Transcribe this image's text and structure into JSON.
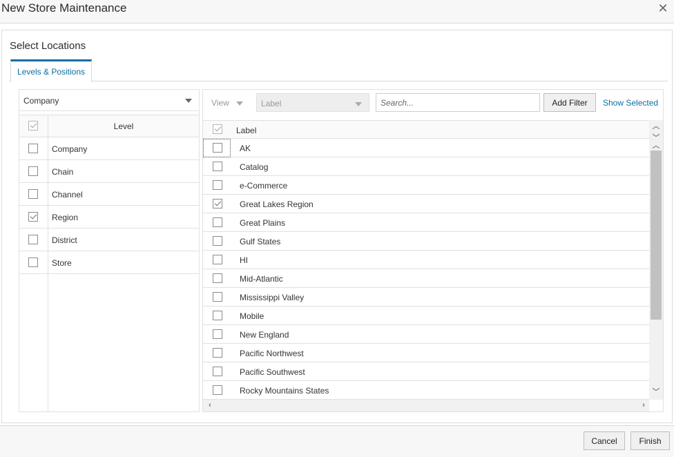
{
  "dialog": {
    "title": "New Store Maintenance",
    "close_glyph": "✕"
  },
  "section_title": "Select Locations",
  "tabs": [
    {
      "label": "Levels & Positions",
      "active": true
    }
  ],
  "left_panel": {
    "dropdown_value": "Company",
    "header_label": "Level",
    "header_checkbox_checked": true,
    "rows": [
      {
        "label": "Company",
        "checked": false
      },
      {
        "label": "Chain",
        "checked": false
      },
      {
        "label": "Channel",
        "checked": false
      },
      {
        "label": "Region",
        "checked": true
      },
      {
        "label": "District",
        "checked": false
      },
      {
        "label": "Store",
        "checked": false
      }
    ]
  },
  "right_panel": {
    "view_label": "View",
    "label_select_value": "Label",
    "search_placeholder": "Search...",
    "add_filter_label": "Add Filter",
    "show_selected_label": "Show Selected",
    "header_label": "Label",
    "header_checkbox_checked": true,
    "rows": [
      {
        "label": "AK",
        "checked": false
      },
      {
        "label": "Catalog",
        "checked": false
      },
      {
        "label": "e-Commerce",
        "checked": false
      },
      {
        "label": "Great Lakes Region",
        "checked": true
      },
      {
        "label": "Great Plains",
        "checked": false
      },
      {
        "label": "Gulf States",
        "checked": false
      },
      {
        "label": "HI",
        "checked": false
      },
      {
        "label": "Mid-Atlantic",
        "checked": false
      },
      {
        "label": "Mississippi Valley",
        "checked": false
      },
      {
        "label": "Mobile",
        "checked": false
      },
      {
        "label": "New England",
        "checked": false
      },
      {
        "label": "Pacific Northwest",
        "checked": false
      },
      {
        "label": "Pacific Southwest",
        "checked": false
      },
      {
        "label": "Rocky Mountains States",
        "checked": false
      }
    ]
  },
  "footer": {
    "cancel_label": "Cancel",
    "finish_label": "Finish"
  },
  "colors": {
    "accent": "#0a6ea0"
  }
}
